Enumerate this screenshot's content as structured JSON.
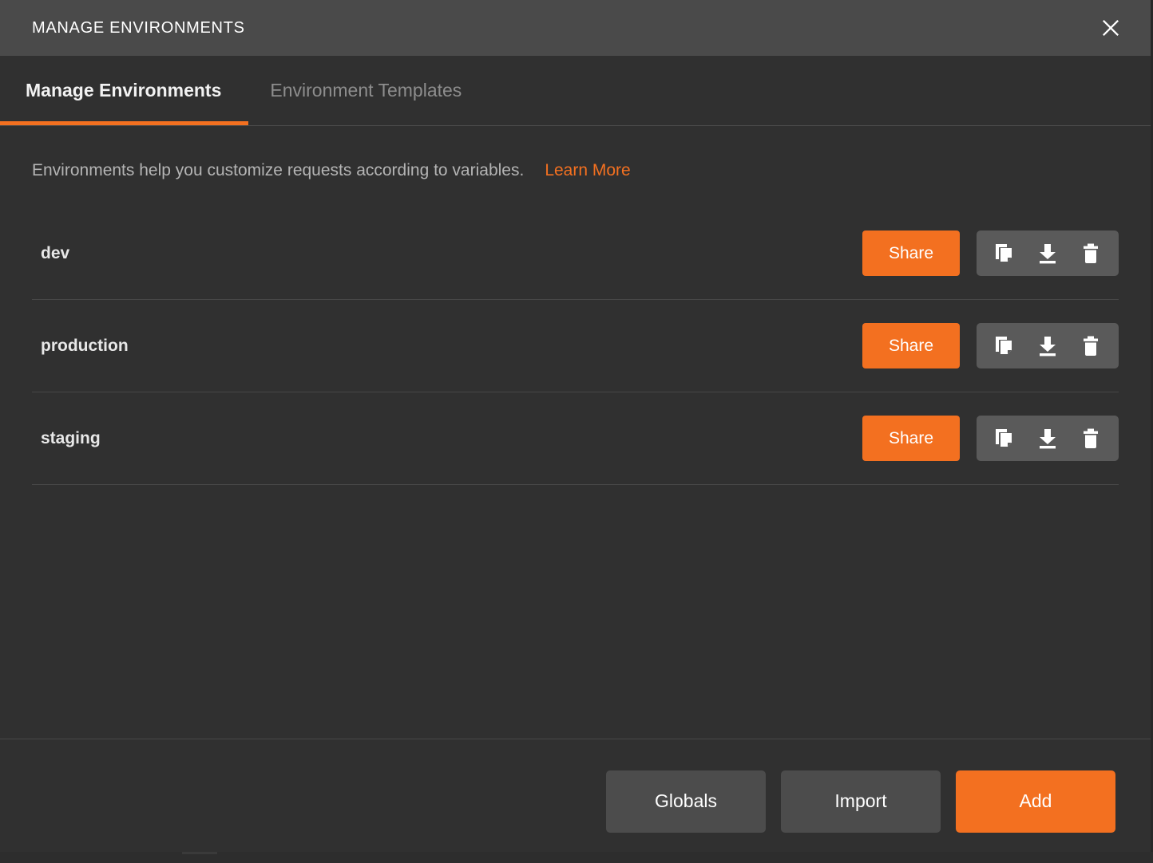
{
  "header": {
    "title": "MANAGE ENVIRONMENTS",
    "close_icon": "close-icon"
  },
  "tabs": [
    {
      "label": "Manage Environments",
      "active": true
    },
    {
      "label": "Environment Templates",
      "active": false
    }
  ],
  "description": {
    "text": "Environments help you customize requests according to variables.",
    "link_label": "Learn More"
  },
  "environments": [
    {
      "name": "dev",
      "share_label": "Share",
      "actions": [
        "copy-icon",
        "download-icon",
        "trash-icon"
      ]
    },
    {
      "name": "production",
      "share_label": "Share",
      "actions": [
        "copy-icon",
        "download-icon",
        "trash-icon"
      ]
    },
    {
      "name": "staging",
      "share_label": "Share",
      "actions": [
        "copy-icon",
        "download-icon",
        "trash-icon"
      ]
    }
  ],
  "footer": {
    "globals_label": "Globals",
    "import_label": "Import",
    "add_label": "Add"
  },
  "colors": {
    "accent": "#f37020",
    "header_bg": "#4a4a4a",
    "body_bg": "#303030",
    "icon_group_bg": "#5a5a5a",
    "secondary_btn": "#4c4c4c",
    "divider": "#474747",
    "inactive_tab_text": "#8d8d8d"
  }
}
